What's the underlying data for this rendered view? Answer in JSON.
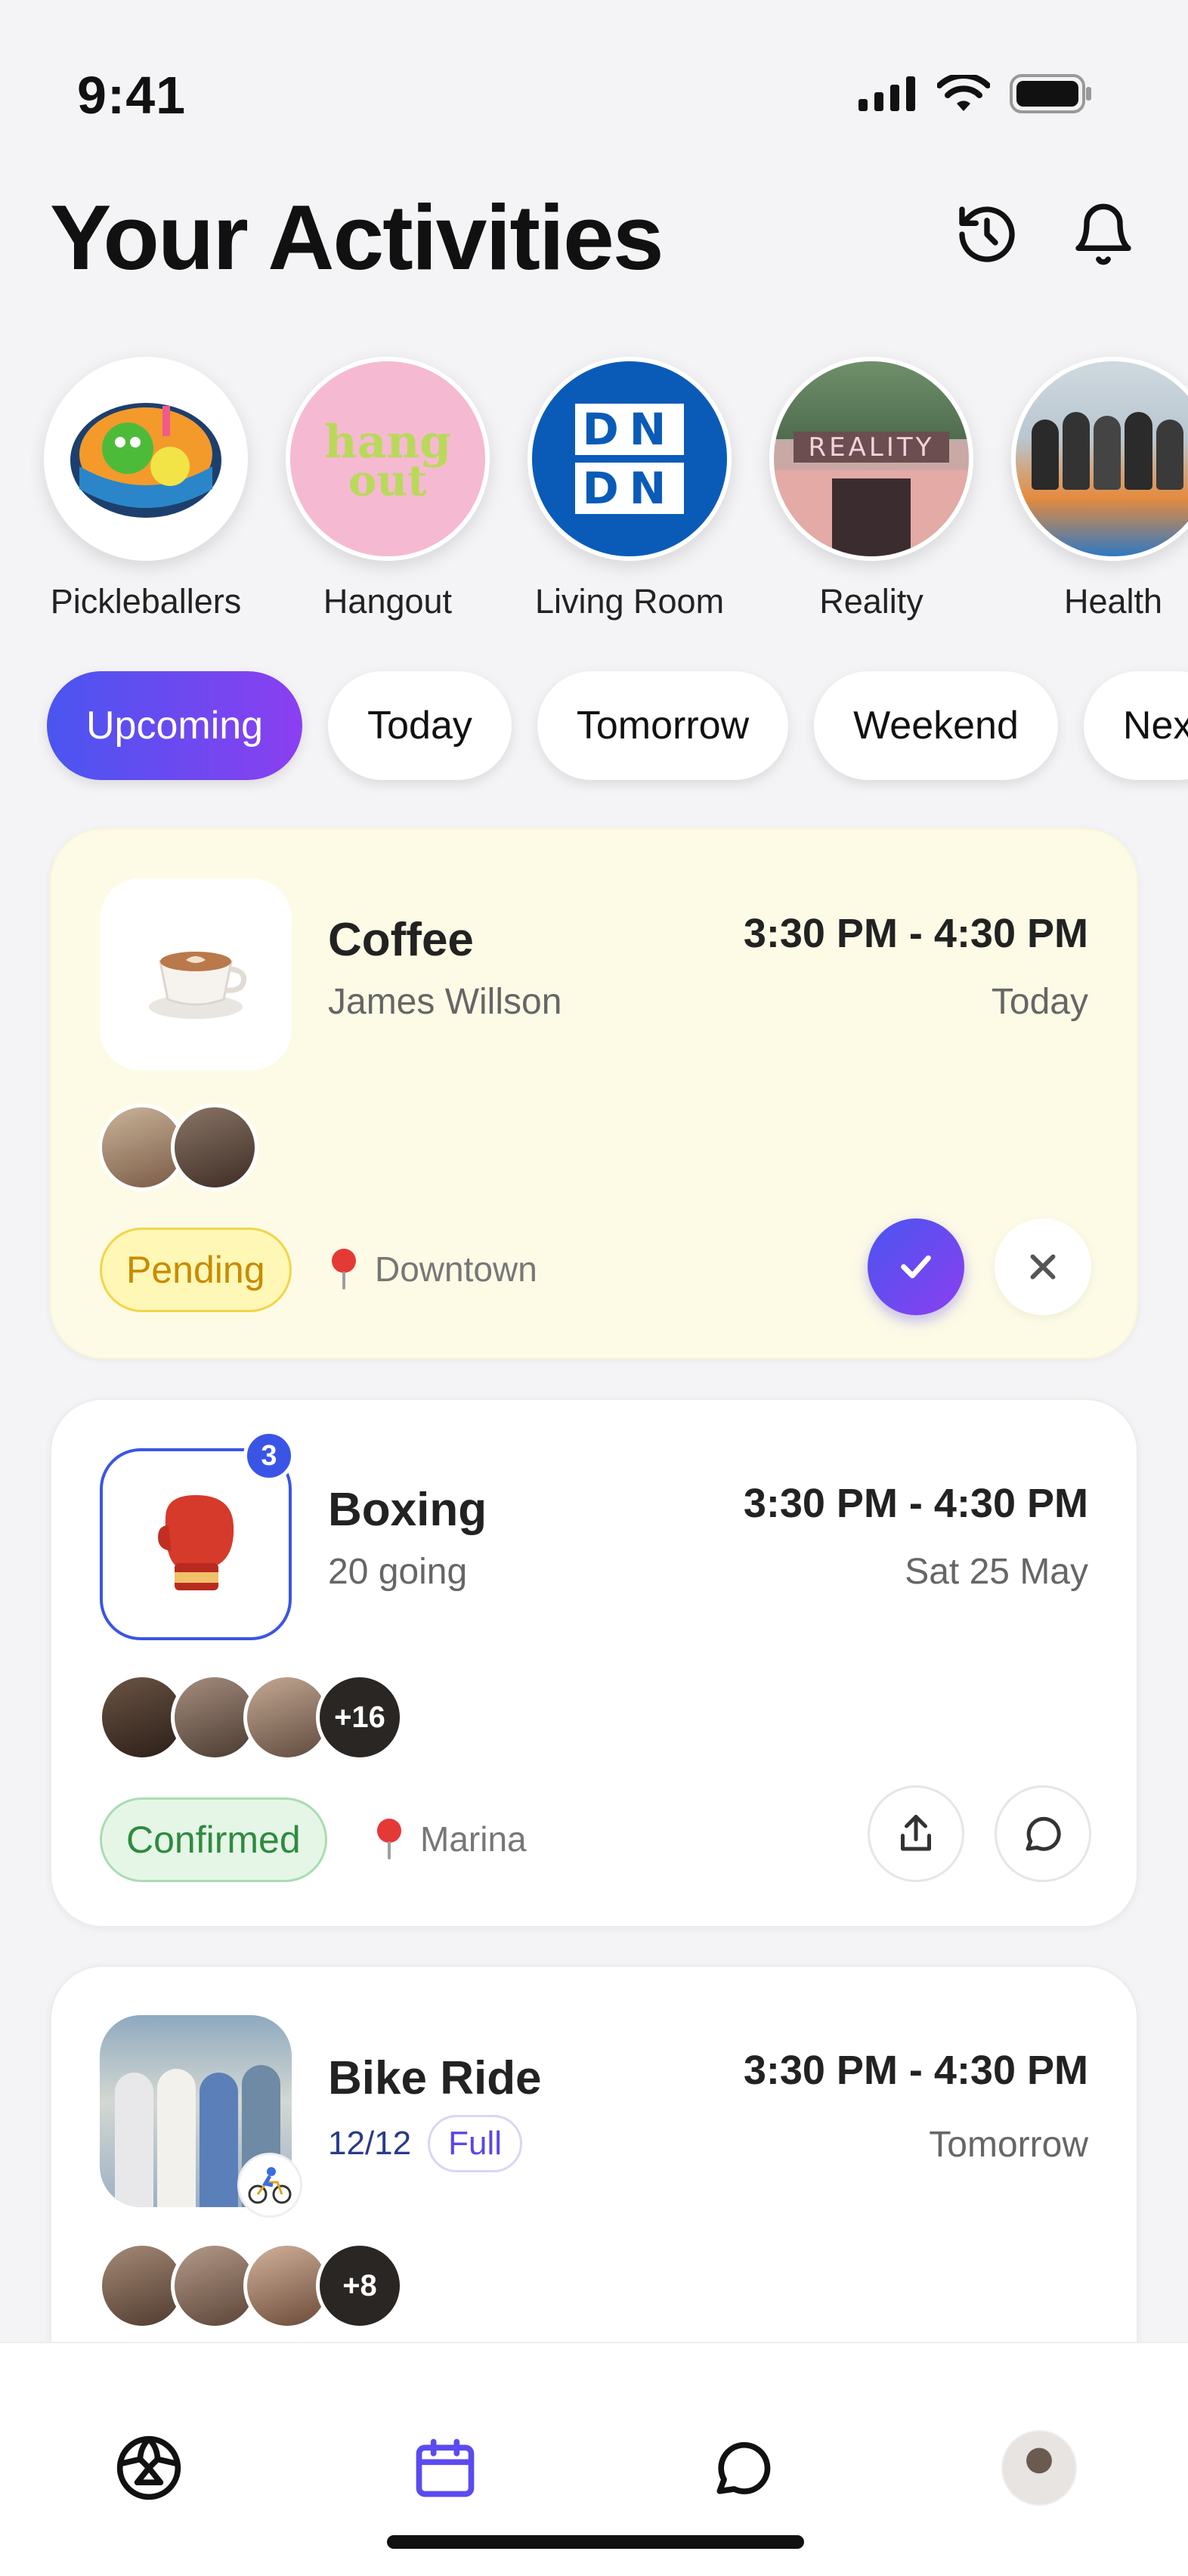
{
  "status_bar": {
    "time": "9:41"
  },
  "header": {
    "title": "Your Activities"
  },
  "groups": [
    {
      "label": "Pickleballers"
    },
    {
      "label": "Hangout"
    },
    {
      "label": "Living Room",
      "logo_text_1": "DN",
      "logo_text_2": "DN"
    },
    {
      "label": "Reality",
      "sign_text": "REALITY"
    },
    {
      "label": "Health"
    }
  ],
  "filters": [
    "Upcoming",
    "Today",
    "Tomorrow",
    "Weekend",
    "Nex"
  ],
  "cards": [
    {
      "title": "Coffee",
      "subtitle": "James Willson",
      "time": "3:30 PM - 4:30 PM",
      "date": "Today",
      "status": "Pending",
      "location": "Downtown"
    },
    {
      "title": "Boxing",
      "subtitle": "20 going",
      "time": "3:30 PM - 4:30 PM",
      "date": "Sat 25 May",
      "status": "Confirmed",
      "location": "Marina",
      "badge": "3",
      "more_count": "+16"
    },
    {
      "title": "Bike Ride",
      "capacity": "12/12",
      "capacity_label": "Full",
      "time": "3:30 PM - 4:30 PM",
      "date": "Tomorrow",
      "more_count": "+8"
    }
  ],
  "colors": {
    "accent_start": "#4a55f0",
    "accent_end": "#8b3ff0",
    "pending": "#c98a00",
    "confirmed": "#2e8b3f"
  },
  "tabs": [
    {
      "icon": "explore-ball-icon"
    },
    {
      "icon": "calendar-icon",
      "active": true
    },
    {
      "icon": "chat-icon"
    },
    {
      "icon": "profile-avatar"
    }
  ]
}
